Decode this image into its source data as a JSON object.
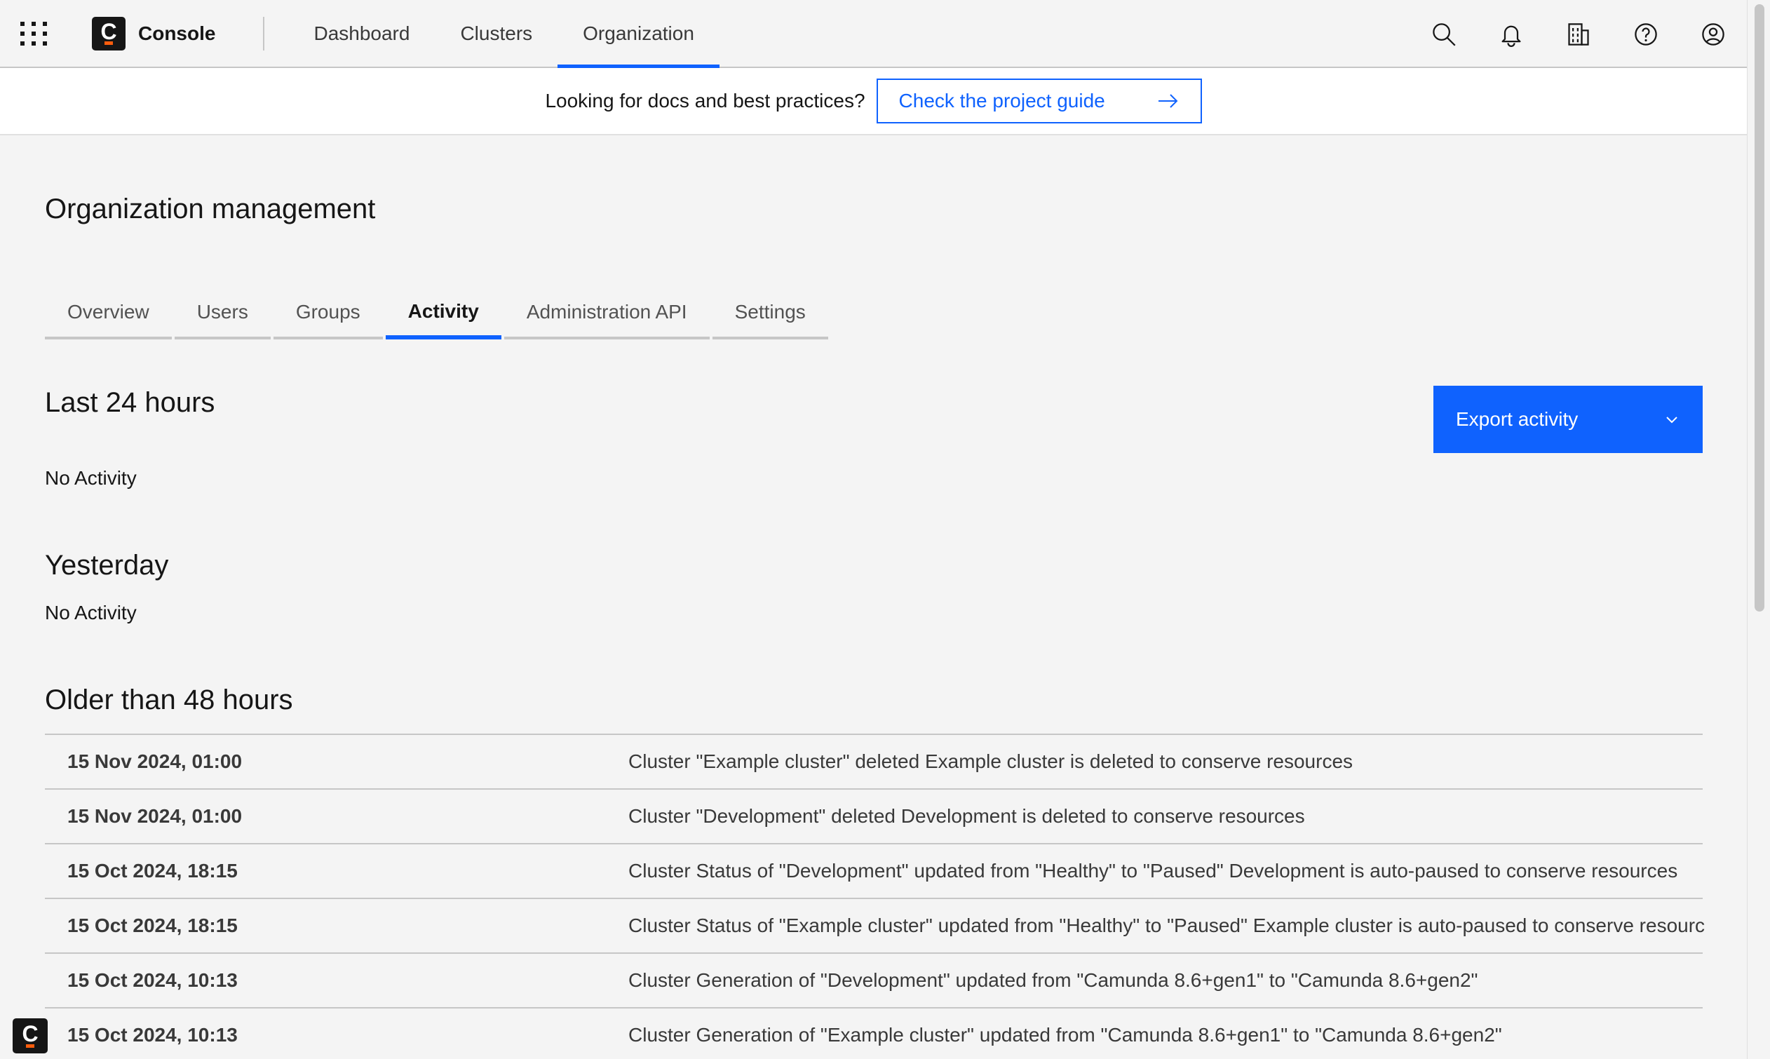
{
  "header": {
    "brand": "Console",
    "nav": [
      {
        "label": "Dashboard",
        "active": false
      },
      {
        "label": "Clusters",
        "active": false
      },
      {
        "label": "Organization",
        "active": true
      }
    ]
  },
  "banner": {
    "text": "Looking for docs and best practices?",
    "button_label": "Check the project guide"
  },
  "page": {
    "title": "Organization management",
    "tabs": [
      {
        "label": "Overview",
        "active": false
      },
      {
        "label": "Users",
        "active": false
      },
      {
        "label": "Groups",
        "active": false
      },
      {
        "label": "Activity",
        "active": true
      },
      {
        "label": "Administration API",
        "active": false
      },
      {
        "label": "Settings",
        "active": false
      }
    ],
    "export_label": "Export activity",
    "sections": {
      "last24": {
        "heading": "Last 24 hours",
        "empty": "No Activity"
      },
      "yesterday": {
        "heading": "Yesterday",
        "empty": "No Activity"
      },
      "older": {
        "heading": "Older than 48 hours"
      }
    },
    "activity": [
      {
        "date": "15 Nov 2024, 01:00",
        "description": "Cluster \"Example cluster\" deleted Example cluster is deleted to conserve resources"
      },
      {
        "date": "15 Nov 2024, 01:00",
        "description": "Cluster \"Development\" deleted Development is deleted to conserve resources"
      },
      {
        "date": "15 Oct 2024, 18:15",
        "description": "Cluster Status of \"Development\" updated from \"Healthy\" to \"Paused\" Development is auto-paused to conserve resources"
      },
      {
        "date": "15 Oct 2024, 18:15",
        "description": "Cluster Status of \"Example cluster\" updated from \"Healthy\" to \"Paused\" Example cluster is auto-paused to conserve resourc"
      },
      {
        "date": "15 Oct 2024, 10:13",
        "description": "Cluster Generation of \"Development\" updated from \"Camunda 8.6+gen1\" to \"Camunda 8.6+gen2\""
      },
      {
        "date": "15 Oct 2024, 10:13",
        "description": "Cluster Generation of \"Example cluster\" updated from \"Camunda 8.6+gen1\" to \"Camunda 8.6+gen2\""
      }
    ]
  },
  "logo_letter": "C",
  "colors": {
    "accent": "#0f62fe",
    "logo_bar": "#fc5d0d",
    "background": "#f4f4f4"
  }
}
